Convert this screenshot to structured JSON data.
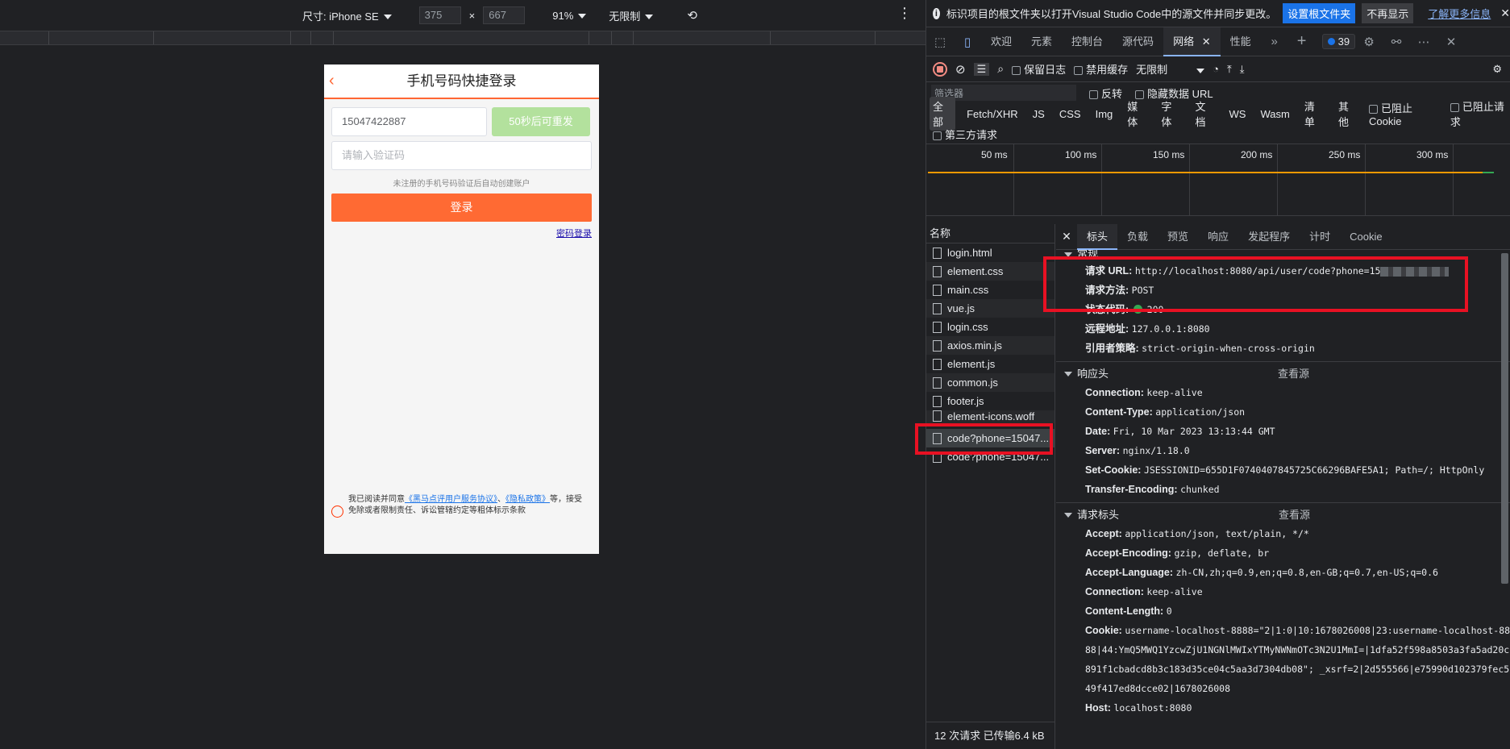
{
  "device_toolbar": {
    "size_label": "尺寸: iPhone SE",
    "width": "375",
    "height": "667",
    "zoom": "91%",
    "throttle": "无限制"
  },
  "phone": {
    "title": "手机号码快捷登录",
    "phone_value": "15047422887",
    "resend_label": "50秒后可重发",
    "code_placeholder": "请输入验证码",
    "hint": "未注册的手机号码验证后自动创建账户",
    "login_label": "登录",
    "pwd_login": "密码登录",
    "agree_prefix": "我已阅读并同意",
    "agree_link1": "《黑马点评用户服务协议》",
    "agree_sep": "、",
    "agree_link2": "《隐私政策》",
    "agree_suffix": "等，接受免除或者限制责任、诉讼管辖约定等粗体标示条款"
  },
  "infobar": {
    "message": "标识项目的根文件夹以打开Visual Studio Code中的源文件并同步更改。",
    "set_root": "设置根文件夹",
    "dont_show": "不再显示",
    "learn_more": "了解更多信息"
  },
  "tabs": {
    "items": [
      "欢迎",
      "元素",
      "控制台",
      "源代码",
      "网络",
      "性能"
    ],
    "active": "网络",
    "issues_count": "39"
  },
  "net_toolbar": {
    "preserve_log": "保留日志",
    "disable_cache": "禁用缓存",
    "throttle": "无限制"
  },
  "filter": {
    "placeholder": "筛选器",
    "invert": "反转",
    "hide_data_urls": "隐藏数据 URL",
    "types": [
      "全部",
      "Fetch/XHR",
      "JS",
      "CSS",
      "Img",
      "媒体",
      "字体",
      "文档",
      "WS",
      "Wasm",
      "清单",
      "其他"
    ],
    "blocked_cookies": "已阻止 Cookie",
    "blocked_requests": "已阻止请求",
    "third_party": "第三方请求"
  },
  "timeline": {
    "labels": [
      "50 ms",
      "100 ms",
      "150 ms",
      "200 ms",
      "250 ms",
      "300 ms"
    ]
  },
  "requests": {
    "header": "名称",
    "files": [
      "login.html",
      "element.css",
      "main.css",
      "vue.js",
      "login.css",
      "axios.min.js",
      "element.js",
      "common.js",
      "footer.js",
      "element-icons.woff",
      "code?phone=15047...",
      "code?phone=15047..."
    ],
    "footer": "12 次请求  已传输6.4 kB"
  },
  "detail_tabs": [
    "标头",
    "负载",
    "预览",
    "响应",
    "发起程序",
    "计时",
    "Cookie"
  ],
  "general": {
    "title": "常规",
    "url_label": "请求 URL:",
    "url_value": "http://localhost:8080/api/user/code?phone=15",
    "method_label": "请求方法:",
    "method_value": "POST",
    "status_label": "状态代码:",
    "status_value": "200",
    "remote_label": "远程地址:",
    "remote_value": "127.0.0.1:8080",
    "referrer_label": "引用者策略:",
    "referrer_value": "strict-origin-when-cross-origin"
  },
  "response_headers": {
    "title": "响应头",
    "view_source": "查看源",
    "items": [
      {
        "k": "Connection:",
        "v": "keep-alive"
      },
      {
        "k": "Content-Type:",
        "v": "application/json"
      },
      {
        "k": "Date:",
        "v": "Fri, 10 Mar 2023 13:13:44 GMT"
      },
      {
        "k": "Server:",
        "v": "nginx/1.18.0"
      },
      {
        "k": "Set-Cookie:",
        "v": "JSESSIONID=655D1F0740407845725C66296BAFE5A1; Path=/; HttpOnly"
      },
      {
        "k": "Transfer-Encoding:",
        "v": "chunked"
      }
    ]
  },
  "request_headers": {
    "title": "请求标头",
    "view_source": "查看源",
    "items": [
      {
        "k": "Accept:",
        "v": "application/json, text/plain, */*"
      },
      {
        "k": "Accept-Encoding:",
        "v": "gzip, deflate, br"
      },
      {
        "k": "Accept-Language:",
        "v": "zh-CN,zh;q=0.9,en;q=0.8,en-GB;q=0.7,en-US;q=0.6"
      },
      {
        "k": "Connection:",
        "v": "keep-alive"
      },
      {
        "k": "Content-Length:",
        "v": "0"
      },
      {
        "k": "Cookie:",
        "v": "username-localhost-8888=\"2|1:0|10:1678026008|23:username-localhost-8888|44:YmQ5MWQ1YzcwZjU1NGNlMWIxYTMyNWNmOTc3N2U1MmI=|1dfa52f598a8503a3fa5ad20c891f1cbadcd8b3c183d35ce04c5aa3d7304db08\"; _xsrf=2|2d555566|e75990d102379fec549f417ed8dcce02|1678026008"
      },
      {
        "k": "Host:",
        "v": "localhost:8080"
      }
    ]
  }
}
